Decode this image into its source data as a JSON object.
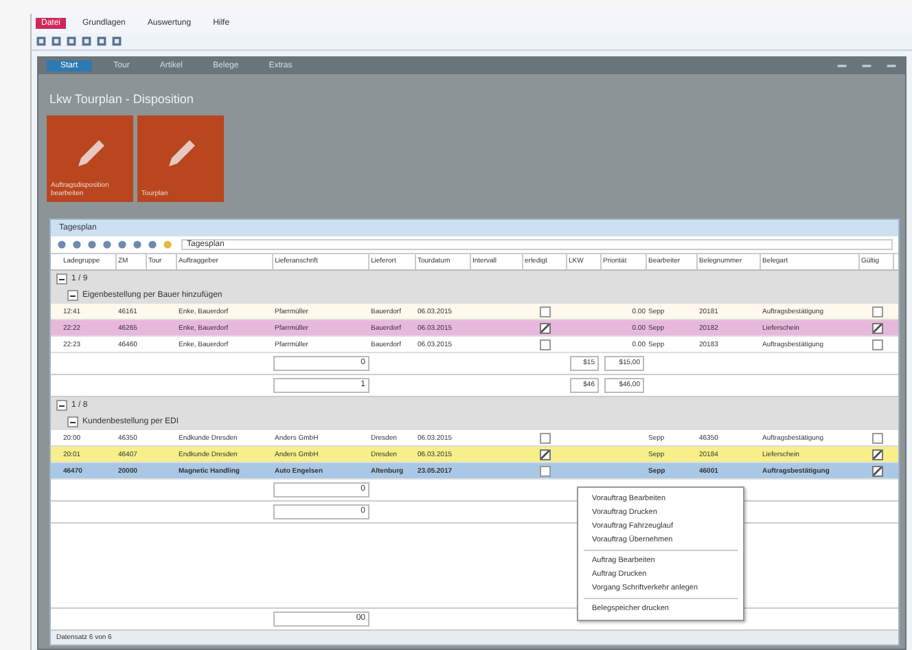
{
  "menu": [
    {
      "label": "Datei",
      "selected": true
    },
    {
      "label": "Grundlagen",
      "selected": false
    },
    {
      "label": "Auswertung",
      "selected": false
    },
    {
      "label": "Hilfe",
      "selected": false
    }
  ],
  "tabs": [
    {
      "label": "Start",
      "selected": true
    },
    {
      "label": "Tour",
      "selected": false
    },
    {
      "label": "Artikel",
      "selected": false
    },
    {
      "label": "Belege",
      "selected": false
    },
    {
      "label": "Extras",
      "selected": false
    }
  ],
  "page_title": "Lkw Tourplan - Disposition",
  "tiles": [
    {
      "label": "Auftragsdisposition bearbeiten"
    },
    {
      "label": "Tourplan"
    }
  ],
  "inner_window": {
    "title": "Tagesplan",
    "search": "Tagesplan",
    "columns": [
      "Ladegruppe",
      "ZM",
      "Tour",
      "Auftraggeber",
      "Lieferanschrift",
      "Lieferort",
      "Tourdatum",
      "Intervall",
      "erledigt",
      "LKW",
      "Priorität",
      "Bearbeiter",
      "Belegnummer",
      "Belegart",
      "Gültig"
    ],
    "rows": [
      {
        "kind": "group",
        "label": "1 / 9",
        "expanded": true
      },
      {
        "kind": "subgroup",
        "label": "Eigenbestellung per Bauer hinzufügen",
        "expanded": true
      },
      {
        "kind": "data",
        "color": "#fff8ec",
        "selected": false,
        "cells": [
          "12:41",
          "46161",
          "",
          "Enke, Bauerdorf",
          "Pfarrmüller",
          "Bauerdorf",
          "06.03.2015",
          "",
          "",
          "0.00",
          "Sepp",
          "20181",
          "Auftragsbestätigung"
        ],
        "done": false,
        "valid": false
      },
      {
        "kind": "data",
        "color": "#e8b8dc",
        "selected": false,
        "cells": [
          "22:22",
          "46265",
          "",
          "Enke, Bauerdorf",
          "Pfarrmüller",
          "Bauerdorf",
          "06.03.2015",
          "",
          "",
          "0.00",
          "Sepp",
          "20182",
          "Lieferschein"
        ],
        "done": true,
        "valid": true
      },
      {
        "kind": "data",
        "color": "#ffffff",
        "selected": false,
        "cells": [
          "22:23",
          "46460",
          "",
          "Enke, Bauerdorf",
          "Pfarrmüller",
          "Bauerdorf",
          "06.03.2015",
          "",
          "",
          "0.00",
          "Sepp",
          "20183",
          "Auftragsbestätigung"
        ],
        "done": false,
        "valid": false
      },
      {
        "kind": "sum",
        "value": "0",
        "lkw": "$15",
        "priority": "$15,00"
      },
      {
        "kind": "sum",
        "value": "1",
        "lkw": "$46",
        "priority": "$46,00"
      },
      {
        "kind": "group",
        "label": "1 / 8",
        "expanded": true
      },
      {
        "kind": "subgroup",
        "label": "Kundenbestellung per EDI",
        "expanded": true
      },
      {
        "kind": "data",
        "color": "#ffffff",
        "selected": false,
        "cells": [
          "20:00",
          "46350",
          "",
          "Endkunde Dresden",
          "Anders GmbH",
          "Dresden",
          "06.03.2015",
          "",
          "",
          "",
          "Sepp",
          "46350",
          "Auftragsbestätigung"
        ],
        "done": false,
        "valid": false
      },
      {
        "kind": "data",
        "color": "#f6ef8a",
        "selected": false,
        "cells": [
          "20:01",
          "46407",
          "",
          "Endkunde Dresden",
          "Anders GmbH",
          "Dresden",
          "06.03.2015",
          "",
          "",
          "",
          "Sepp",
          "20184",
          "Lieferschein"
        ],
        "done": true,
        "valid": true
      },
      {
        "kind": "data",
        "color": "#a9c8e6",
        "selected": true,
        "cells": [
          "46470",
          "20000",
          "",
          "Magnetic Handling",
          "Auto Engelsen",
          "Altenburg",
          "23.05.2017",
          "",
          "",
          "",
          "Sepp",
          "46001",
          "Auftragsbestätigung"
        ],
        "done": false,
        "valid": true
      },
      {
        "kind": "sum",
        "value": "0"
      },
      {
        "kind": "sum",
        "value": "0"
      }
    ],
    "total": "00",
    "status": "Datensatz 6 von 6"
  },
  "context_menu": [
    {
      "label": "Vorauftrag Bearbeiten",
      "separator_before": false
    },
    {
      "label": "Vorauftrag Drucken",
      "separator_before": false
    },
    {
      "label": "Vorauftrag Fahrzeuglauf",
      "separator_before": false
    },
    {
      "label": "Vorauftrag Übernehmen",
      "separator_before": false
    },
    {
      "label": "Auftrag Bearbeiten",
      "separator_before": true
    },
    {
      "label": "Auftrag Drucken",
      "separator_before": false
    },
    {
      "label": "Vorgang Schriftverkehr anlegen",
      "separator_before": false
    },
    {
      "label": "Belegspeicher drucken",
      "separator_before": true
    }
  ]
}
